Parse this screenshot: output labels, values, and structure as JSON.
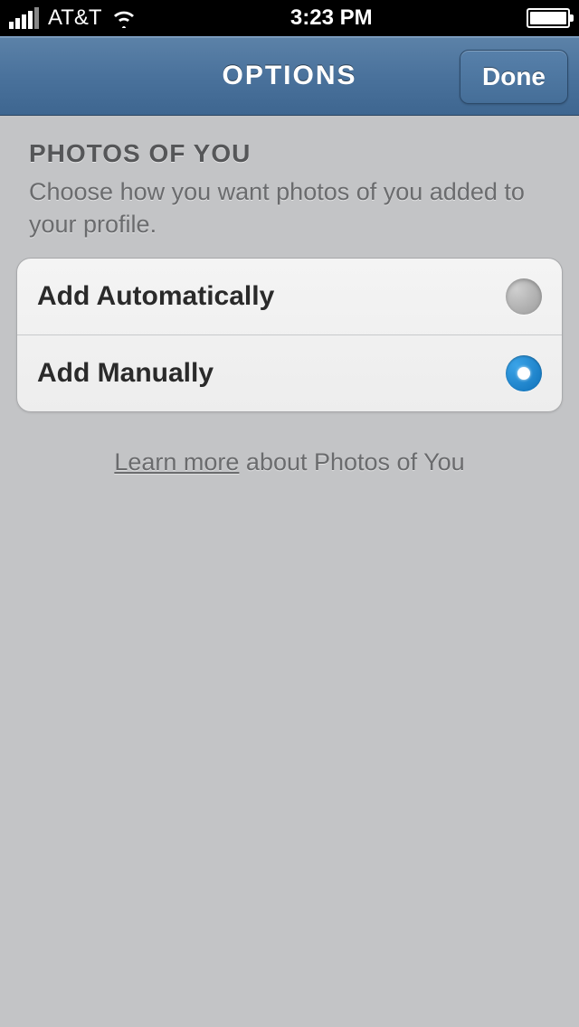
{
  "status_bar": {
    "carrier": "AT&T",
    "time": "3:23 PM"
  },
  "navbar": {
    "title": "OPTIONS",
    "done_label": "Done"
  },
  "section": {
    "title": "PHOTOS OF YOU",
    "subtitle": "Choose how you want photos of you added to your profile."
  },
  "options": {
    "auto_label": "Add Automatically",
    "manual_label": "Add Manually",
    "selected": "manual"
  },
  "footer": {
    "learn_more_link": "Learn more",
    "learn_more_rest": " about Photos of You"
  }
}
